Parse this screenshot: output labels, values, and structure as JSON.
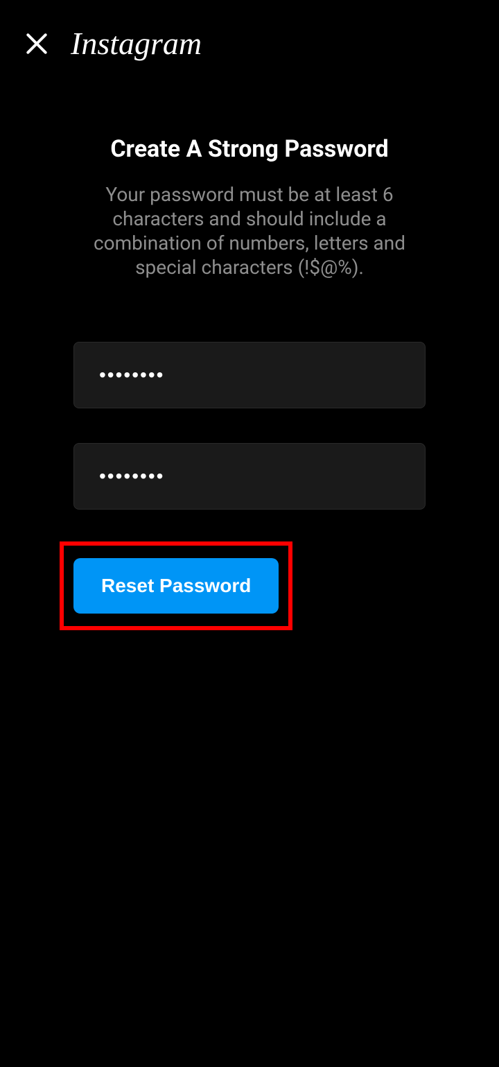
{
  "header": {
    "logo_text": "Instagram"
  },
  "main": {
    "title": "Create A Strong Password",
    "description": "Your password must be at least 6 characters and should include a combination of numbers, letters and special characters (!$@%).",
    "password_value": "••••••••",
    "confirm_password_value": "••••••••",
    "reset_button_label": "Reset Password"
  }
}
